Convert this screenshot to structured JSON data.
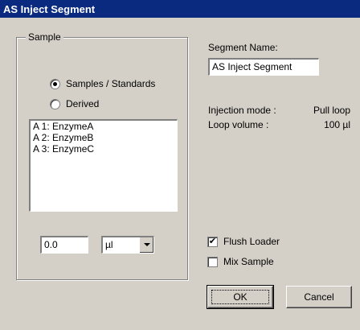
{
  "window": {
    "title": "AS Inject Segment"
  },
  "sample_group": {
    "title": "Sample",
    "radio_samples": "Samples / Standards",
    "radio_derived": "Derived",
    "list": [
      "A 1: EnzymeA",
      "A 2: EnzymeB",
      "A 3: EnzymeC"
    ],
    "volume_value": "0.0",
    "unit_selected": "µl"
  },
  "segment": {
    "name_label": "Segment Name:",
    "name_value": "AS Inject Segment",
    "injection_mode_label": "Injection mode :",
    "injection_mode_value": "Pull loop",
    "loop_volume_label": "Loop volume :",
    "loop_volume_value": "100 µl"
  },
  "options": {
    "flush_loader": "Flush Loader",
    "flush_loader_checked": true,
    "mix_sample": "Mix Sample",
    "mix_sample_checked": false
  },
  "buttons": {
    "ok": "OK",
    "cancel": "Cancel"
  }
}
